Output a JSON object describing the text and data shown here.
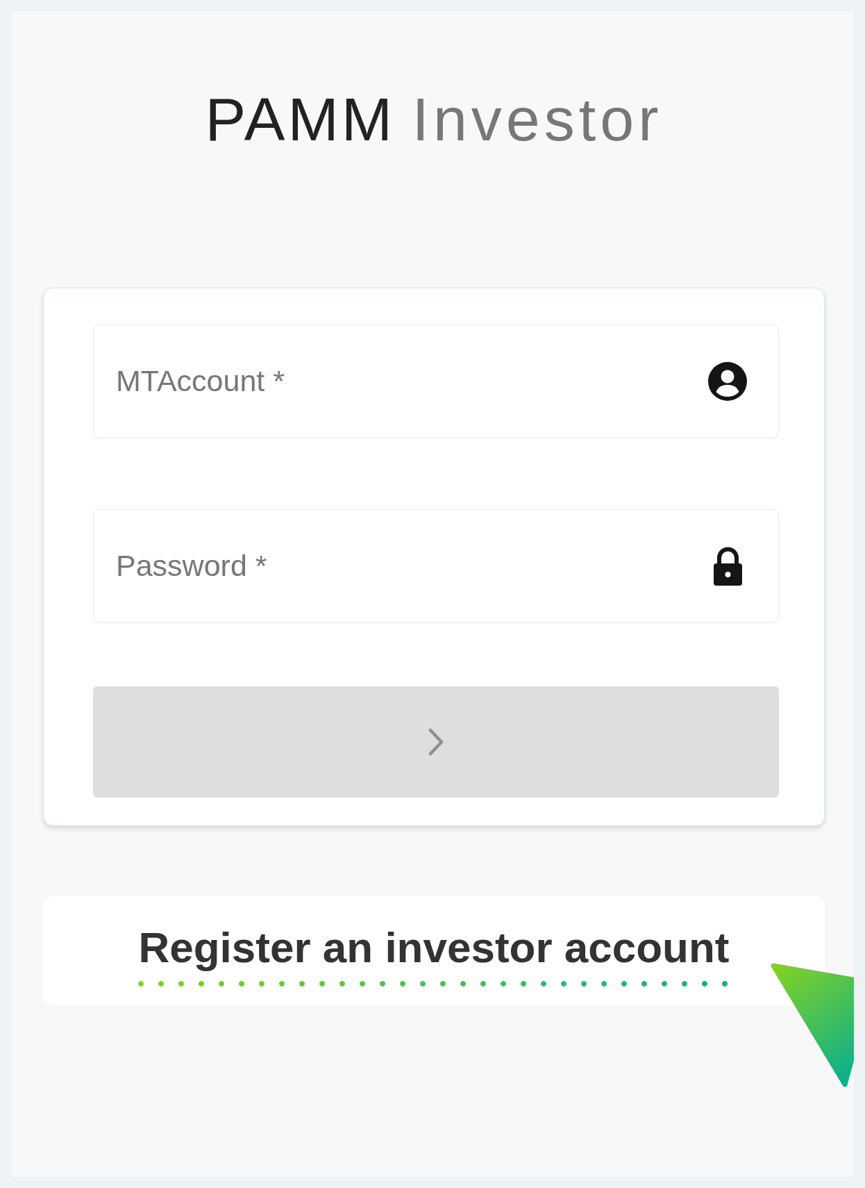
{
  "title": {
    "brand": "PAMM",
    "product": "Investor"
  },
  "login_form": {
    "fields": [
      {
        "kind": "account",
        "placeholder": "MTAccount *"
      },
      {
        "kind": "password",
        "placeholder": "Password *"
      }
    ],
    "submit_button": {
      "disabled": true
    }
  },
  "register_link": {
    "label": "Register an investor account"
  }
}
